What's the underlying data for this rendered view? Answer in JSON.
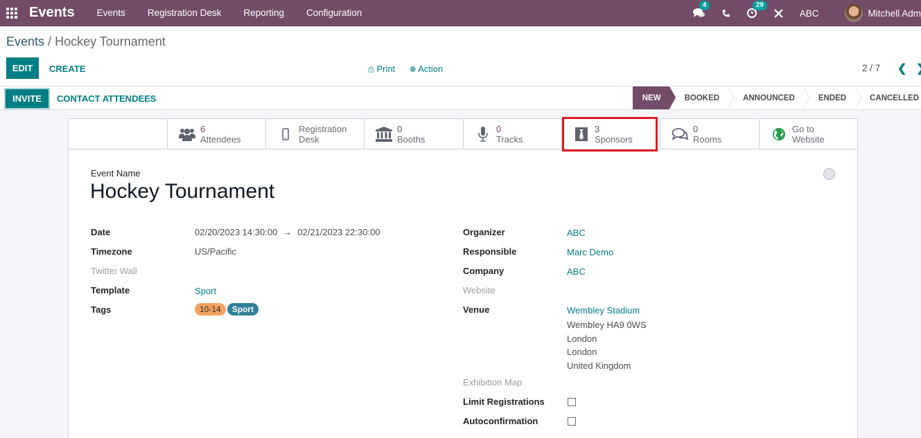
{
  "navbar": {
    "app_name": "Events",
    "menu": [
      "Events",
      "Registration Desk",
      "Reporting",
      "Configuration"
    ],
    "messages_count": "4",
    "activities_count": "29",
    "company": "ABC",
    "user": "Mitchell Adm"
  },
  "breadcrumb": {
    "parent": "Events",
    "separator": "/",
    "current": "Hockey Tournament"
  },
  "toolbar": {
    "edit_label": "EDIT",
    "create_label": "CREATE",
    "print_label": "Print",
    "action_label": "Action",
    "pager": "2 / 7"
  },
  "statusbar": {
    "invite_label": "INVITE",
    "contact_label": "CONTACT ATTENDEES",
    "stages": [
      "NEW",
      "BOOKED",
      "ANNOUNCED",
      "ENDED",
      "CANCELLED"
    ],
    "active_stage": "NEW"
  },
  "smart_buttons": [
    {
      "value": "6",
      "label": "Attendees",
      "icon": "users-icon"
    },
    {
      "value": "Registration",
      "label": "Desk",
      "icon": "mobile-icon"
    },
    {
      "value": "0",
      "label": "Booths",
      "icon": "bank-icon"
    },
    {
      "value": "0",
      "label": "Tracks",
      "icon": "microphone-icon"
    },
    {
      "value": "3",
      "label": "Sponsors",
      "icon": "tie-icon",
      "highlighted": true
    },
    {
      "value": "0",
      "label": "Rooms",
      "icon": "comments-icon"
    },
    {
      "value": "Go to",
      "label": "Website",
      "icon": "globe-icon"
    }
  ],
  "form": {
    "event_name_label": "Event Name",
    "event_name": "Hockey Tournament",
    "left": {
      "date_label": "Date",
      "date_start": "02/20/2023 14:30:00",
      "date_arrow": "→",
      "date_end": "02/21/2023 22:30:00",
      "timezone_label": "Timezone",
      "timezone": "US/Pacific",
      "twitter_label": "Twitter Wall",
      "template_label": "Template",
      "template": "Sport",
      "tags_label": "Tags",
      "tags": [
        {
          "name": "10-14",
          "color": "#f4a460"
        },
        {
          "name": "Sport",
          "color": "#2f8195"
        }
      ]
    },
    "right": {
      "organizer_label": "Organizer",
      "organizer": "ABC",
      "responsible_label": "Responsible",
      "responsible": "Marc Demo",
      "company_label": "Company",
      "company": "ABC",
      "website_label": "Website",
      "venue_label": "Venue",
      "venue_lines": [
        "Wembley Stadium",
        "Wembley HA9 0WS",
        "London",
        "London",
        "United Kingdom"
      ],
      "exhibition_label": "Exhibition Map",
      "limit_label": "Limit Registrations",
      "limit_checked": false,
      "autoconfirm_label": "Autoconfirmation",
      "autoconfirm_checked": false
    }
  },
  "colors": {
    "brand": "#714b67",
    "accent": "#017e84",
    "highlight": "#e01b24"
  }
}
